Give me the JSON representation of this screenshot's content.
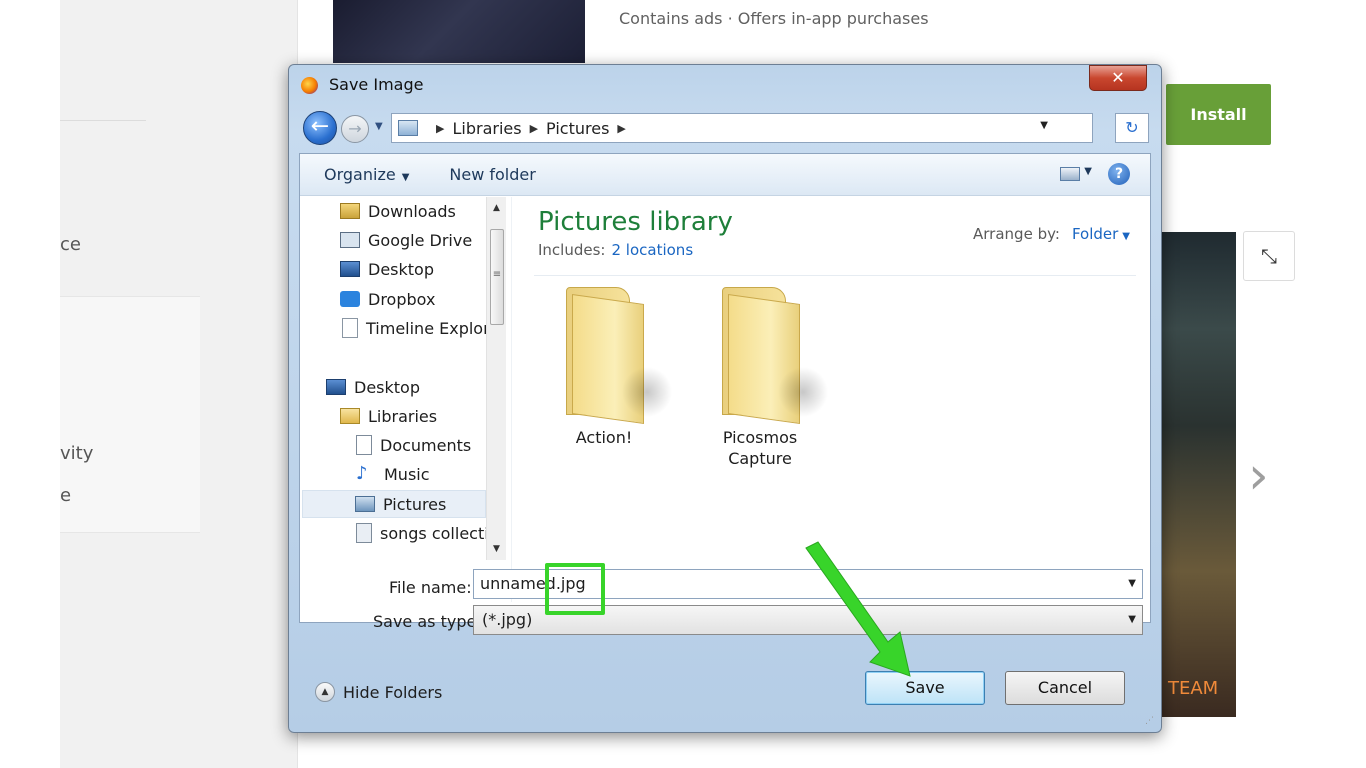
{
  "background": {
    "sidebar_texts": [
      "ce",
      "vity",
      "e"
    ],
    "app_meta": "Contains ads · Offers in-app purchases",
    "install_label": "Install",
    "screenshot_text": "TEAM",
    "expand_icon": "collapse-icon",
    "next_icon": "chevron-right-icon"
  },
  "dialog": {
    "title": "Save Image",
    "close_label": "✕",
    "breadcrumb": [
      "Libraries",
      "Pictures"
    ],
    "toolbar": {
      "organize_label": "Organize",
      "new_folder_label": "New folder",
      "help_label": "?"
    },
    "nav_items": [
      {
        "label": "Downloads",
        "icon": "downloads-icon"
      },
      {
        "label": "Google Drive",
        "icon": "google-drive-icon"
      },
      {
        "label": "Desktop",
        "icon": "desktop-icon"
      },
      {
        "label": "Dropbox",
        "icon": "dropbox-icon"
      },
      {
        "label": "Timeline Explor",
        "icon": "file-icon"
      },
      {
        "label": "Desktop",
        "icon": "desktop-icon"
      },
      {
        "label": "Libraries",
        "icon": "libraries-icon"
      },
      {
        "label": "Documents",
        "icon": "documents-icon"
      },
      {
        "label": "Music",
        "icon": "music-icon"
      },
      {
        "label": "Pictures",
        "icon": "pictures-icon",
        "selected": true
      },
      {
        "label": "songs collecti",
        "icon": "songs-icon"
      }
    ],
    "library": {
      "title": "Pictures library",
      "includes_label": "Includes:",
      "includes_link": "2 locations",
      "arrange_label": "Arrange by:",
      "arrange_value": "Folder"
    },
    "folders": [
      {
        "name": "Action!"
      },
      {
        "name": "Picosmos Capture"
      }
    ],
    "file_name_label": "File name:",
    "file_name_value": "unnamed.jpg",
    "save_type_label": "Save as type:",
    "save_type_value": "(*.jpg)",
    "hide_folders_label": "Hide Folders",
    "save_label": "Save",
    "cancel_label": "Cancel"
  },
  "colors": {
    "install_green": "#689f38",
    "library_title_green": "#1e7f3a",
    "link_blue": "#1a66c2",
    "annotation_green": "#38d42a"
  }
}
